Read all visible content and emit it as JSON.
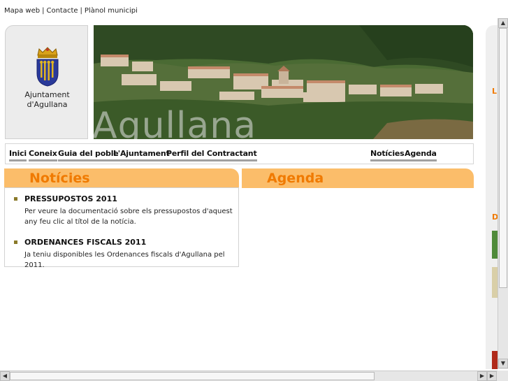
{
  "top_links": [
    "Mapa web",
    "Contacte",
    "Plànol municipi"
  ],
  "separator": "|",
  "logo": {
    "line1": "Ajuntament",
    "line2": "d'Agullana"
  },
  "banner_title": "Agullana",
  "nav_left": [
    "Inici",
    "Coneix",
    "Guia del poble",
    "L'Ajuntament",
    "Perfil del Contractant"
  ],
  "nav_right": [
    "Notícies",
    "Agenda"
  ],
  "news": {
    "heading": "Notícies",
    "items": [
      {
        "title": "PRESSUPOSTOS 2011",
        "text": "Per veure la documentació sobre els pressupostos d'aquest any feu clic al títol de la notícia."
      },
      {
        "title": "ORDENANCES FISCALS 2011",
        "text": "Ja teniu disponibles les Ordenances fiscals d'Agullana pel 2011."
      }
    ]
  },
  "agenda": {
    "heading": "Agenda"
  },
  "right_strip": {
    "letter1": "L",
    "letter2": "D"
  },
  "scroll": {
    "up": "▲",
    "down": "▼",
    "left": "◀",
    "right": "▶"
  },
  "colors": {
    "accent": "#f07a00",
    "tab_bg": "#fbbd6a",
    "nav_underline": "#a0a0a0"
  }
}
